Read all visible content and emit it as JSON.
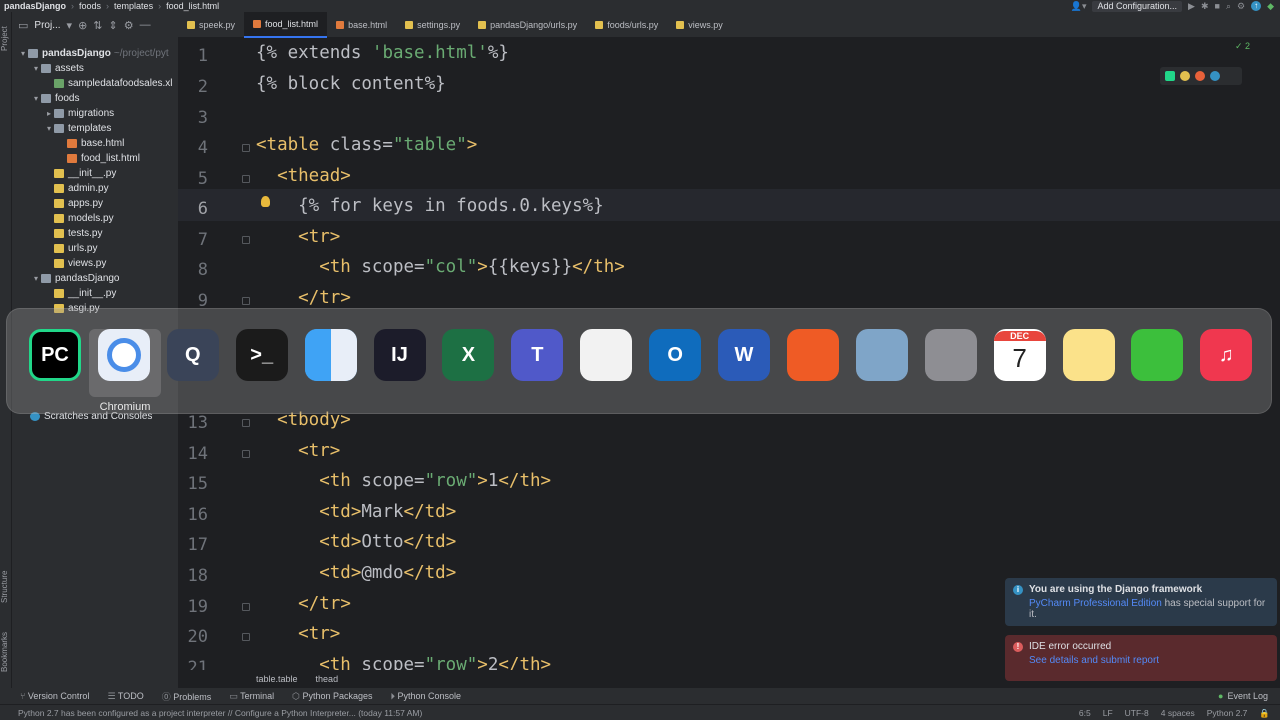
{
  "breadcrumb": {
    "items": [
      "pandasDjango",
      "foods",
      "templates",
      "food_list.html"
    ]
  },
  "toolbar": {
    "add_config_label": "Add Configuration..."
  },
  "sidebar_stripe": {
    "project_label": "Project",
    "structure_label": "Structure",
    "bookmarks_label": "Bookmarks"
  },
  "project_panel": {
    "title": "Proj...",
    "tree": [
      {
        "label": "pandasDjango",
        "extra": "~/project/pyt",
        "kind": "folder",
        "depth": 0,
        "expanded": true,
        "bold": true
      },
      {
        "label": "assets",
        "kind": "folder",
        "depth": 1,
        "expanded": true
      },
      {
        "label": "sampledatafoodsales.xl",
        "kind": "xl",
        "depth": 2
      },
      {
        "label": "foods",
        "kind": "folder",
        "depth": 1,
        "expanded": true
      },
      {
        "label": "migrations",
        "kind": "folder",
        "depth": 2,
        "expanded": false
      },
      {
        "label": "templates",
        "kind": "folder",
        "depth": 2,
        "expanded": true
      },
      {
        "label": "base.html",
        "kind": "html",
        "depth": 3
      },
      {
        "label": "food_list.html",
        "kind": "html",
        "depth": 3
      },
      {
        "label": "__init__.py",
        "kind": "py",
        "depth": 2
      },
      {
        "label": "admin.py",
        "kind": "py",
        "depth": 2
      },
      {
        "label": "apps.py",
        "kind": "py",
        "depth": 2
      },
      {
        "label": "models.py",
        "kind": "py",
        "depth": 2
      },
      {
        "label": "tests.py",
        "kind": "py",
        "depth": 2
      },
      {
        "label": "urls.py",
        "kind": "py",
        "depth": 2
      },
      {
        "label": "views.py",
        "kind": "py",
        "depth": 2
      },
      {
        "label": "pandasDjango",
        "kind": "folder",
        "depth": 1,
        "expanded": true
      },
      {
        "label": "__init__.py",
        "kind": "py",
        "depth": 2
      },
      {
        "label": "asgi.py",
        "kind": "py",
        "depth": 2
      }
    ],
    "scratches_label": "Scratches and Consoles"
  },
  "tabs": [
    {
      "label": "speek.py",
      "kind": "py",
      "active": false
    },
    {
      "label": "food_list.html",
      "kind": "html",
      "active": true
    },
    {
      "label": "base.html",
      "kind": "html",
      "active": false
    },
    {
      "label": "settings.py",
      "kind": "py",
      "active": false
    },
    {
      "label": "pandasDjango/urls.py",
      "kind": "py",
      "active": false
    },
    {
      "label": "foods/urls.py",
      "kind": "py",
      "active": false
    },
    {
      "label": "views.py",
      "kind": "py",
      "active": false
    }
  ],
  "editor": {
    "check_count": "2",
    "current_line": 6,
    "lines": [
      {
        "n": "1",
        "text": "{% extends 'base.html'%}"
      },
      {
        "n": "2",
        "text": "{% block content%}"
      },
      {
        "n": "3",
        "text": ""
      },
      {
        "n": "4",
        "text": "<table class=\"table\">"
      },
      {
        "n": "5",
        "text": "  <thead>"
      },
      {
        "n": "6",
        "text": "    {% for keys in foods.0.keys%}"
      },
      {
        "n": "7",
        "text": "    <tr>"
      },
      {
        "n": "8",
        "text": "      <th scope=\"col\">{{keys}}</th>"
      },
      {
        "n": "9",
        "text": "    </tr>"
      },
      {
        "n": "13",
        "text": "  <tbody>"
      },
      {
        "n": "14",
        "text": "    <tr>"
      },
      {
        "n": "15",
        "text": "      <th scope=\"row\">1</th>"
      },
      {
        "n": "16",
        "text": "      <td>Mark</td>"
      },
      {
        "n": "17",
        "text": "      <td>Otto</td>"
      },
      {
        "n": "18",
        "text": "      <td>@mdo</td>"
      },
      {
        "n": "19",
        "text": "    </tr>"
      },
      {
        "n": "20",
        "text": "    <tr>"
      },
      {
        "n": "21",
        "text": "      <th scope=\"row\">2</th>"
      }
    ],
    "breadcrumb": [
      "table.table",
      "thead"
    ]
  },
  "dock": {
    "hover_label": "Chromium",
    "apps": [
      {
        "name": "pycharm",
        "glyph": "PC",
        "bg": "#21d789"
      },
      {
        "name": "chromium",
        "glyph": "",
        "bg": "#e8eef8"
      },
      {
        "name": "quicktime",
        "glyph": "Q",
        "bg": "#3a4458"
      },
      {
        "name": "terminal",
        "glyph": ">_",
        "bg": "#1b1b1b"
      },
      {
        "name": "finder",
        "glyph": "",
        "bg": "#3fa3f5"
      },
      {
        "name": "intellij",
        "glyph": "IJ",
        "bg": "#1c1c2a"
      },
      {
        "name": "excel",
        "glyph": "X",
        "bg": "#1d7044"
      },
      {
        "name": "teams",
        "glyph": "T",
        "bg": "#5059c9"
      },
      {
        "name": "textedit",
        "glyph": "",
        "bg": "#f2f2f2"
      },
      {
        "name": "outlook",
        "glyph": "O",
        "bg": "#0f6cbd"
      },
      {
        "name": "word",
        "glyph": "W",
        "bg": "#2b5bb8"
      },
      {
        "name": "postman",
        "glyph": "",
        "bg": "#ef5b25"
      },
      {
        "name": "preview",
        "glyph": "",
        "bg": "#7fa5c8"
      },
      {
        "name": "system-preferences",
        "glyph": "",
        "bg": "#8e8e93"
      },
      {
        "name": "calendar",
        "glyph": "7",
        "month": "DEC",
        "bg": "#ffffff"
      },
      {
        "name": "notes",
        "glyph": "",
        "bg": "#fbe28a"
      },
      {
        "name": "numbers",
        "glyph": "",
        "bg": "#3cbf3c"
      },
      {
        "name": "music",
        "glyph": "♫",
        "bg": "#f0374f"
      }
    ]
  },
  "notifications": {
    "django": {
      "title": "You are using the Django framework",
      "link": "PyCharm Professional Edition",
      "body": "has special support for it."
    },
    "error": {
      "title": "IDE error occurred",
      "link": "See details and submit report"
    }
  },
  "bottom_toolbar": {
    "items": [
      "Version Control",
      "TODO",
      "Problems",
      "Terminal",
      "Python Packages",
      "Python Console"
    ],
    "event_log": "Event Log"
  },
  "status_bar": {
    "message": "Python 2.7 has been configured as a project interpreter // Configure a Python Interpreter... (today 11:57 AM)",
    "position": "6:5",
    "line_sep": "LF",
    "encoding": "UTF-8",
    "indent": "4 spaces",
    "interpreter": "Python 2.7"
  },
  "colors": {
    "accent": "#3574f0",
    "tag": "#e8bf6a",
    "string": "#6aab73",
    "error_bg": "#5a2a2d",
    "info_bg": "#2b3a4a"
  }
}
